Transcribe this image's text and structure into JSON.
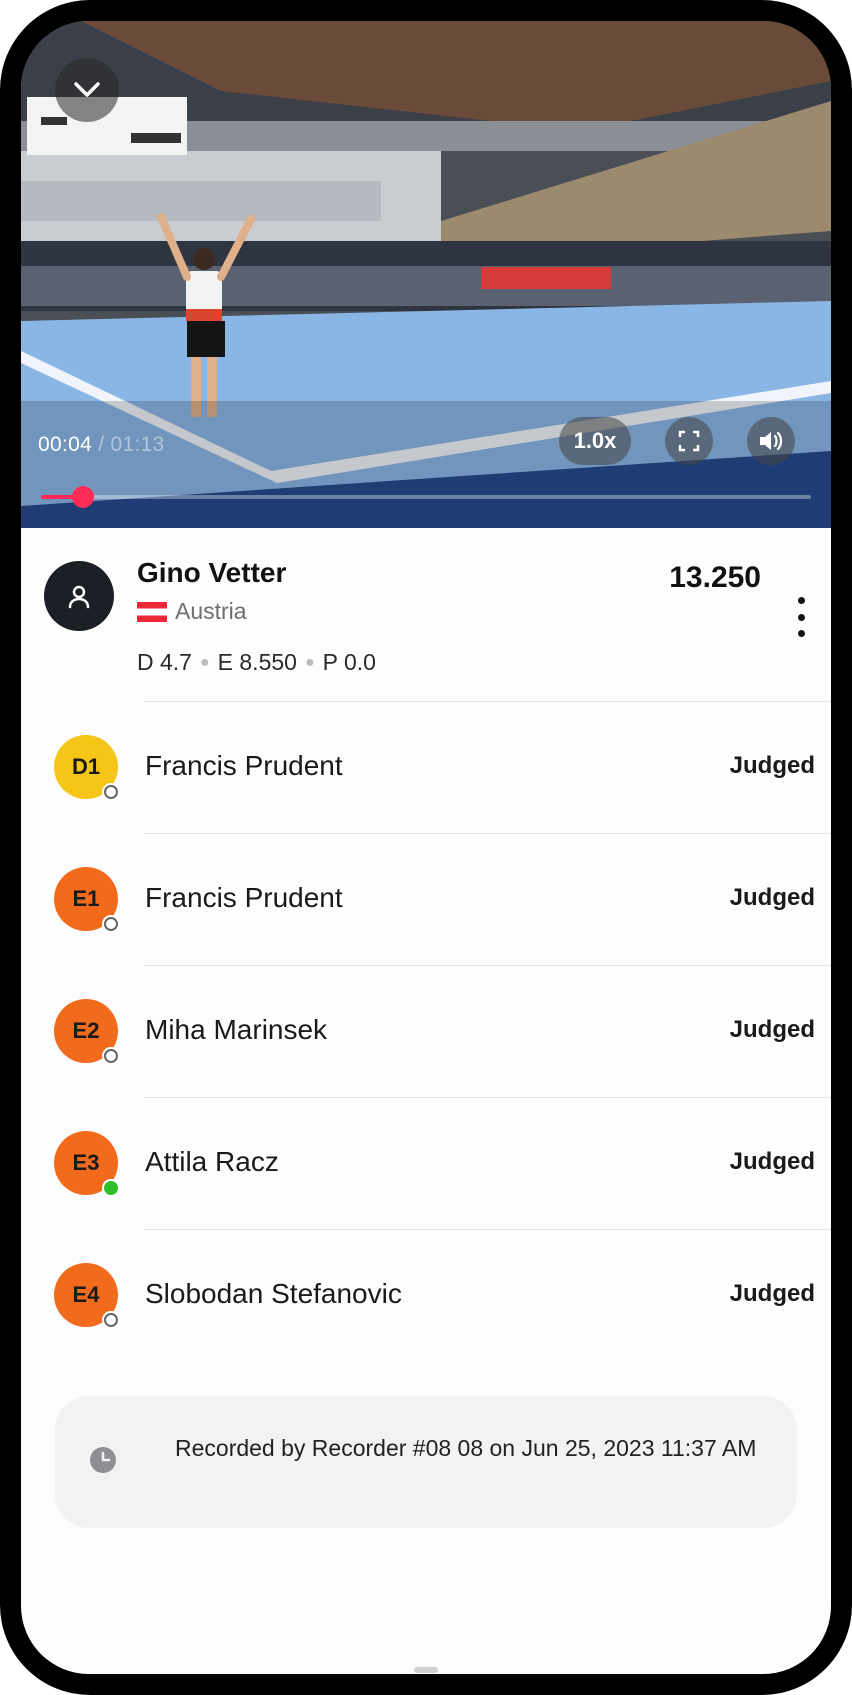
{
  "video": {
    "current_time": "00:04",
    "separator": "/",
    "duration": "01:13",
    "speed": "1.0x",
    "progress_fraction": 0.055,
    "accent": "#ff2d55"
  },
  "athlete": {
    "name": "Gino Vetter",
    "country": "Austria",
    "total_score": "13.250",
    "d_score": "D 4.7",
    "e_score": "E 8.550",
    "p_score": "P 0.0"
  },
  "judges": [
    {
      "code": "D1",
      "name": "Francis Prudent",
      "status": "Judged",
      "badge_color": "#f5c518",
      "online": false
    },
    {
      "code": "E1",
      "name": "Francis Prudent",
      "status": "Judged",
      "badge_color": "#f26b1d",
      "online": false
    },
    {
      "code": "E2",
      "name": "Miha Marinsek",
      "status": "Judged",
      "badge_color": "#f26b1d",
      "online": false
    },
    {
      "code": "E3",
      "name": "Attila Racz",
      "status": "Judged",
      "badge_color": "#f26b1d",
      "online": true
    },
    {
      "code": "E4",
      "name": "Slobodan Stefanovic",
      "status": "Judged",
      "badge_color": "#f26b1d",
      "online": false
    }
  ],
  "recorded": {
    "text": "Recorded by Recorder #08 08 on Jun 25, 2023 11:37 AM"
  },
  "icons": {
    "collapse": "chevron-down-icon",
    "fullscreen": "fullscreen-icon",
    "volume": "volume-icon",
    "avatar": "user-icon",
    "more": "more-vertical-icon",
    "clock": "clock-icon"
  }
}
